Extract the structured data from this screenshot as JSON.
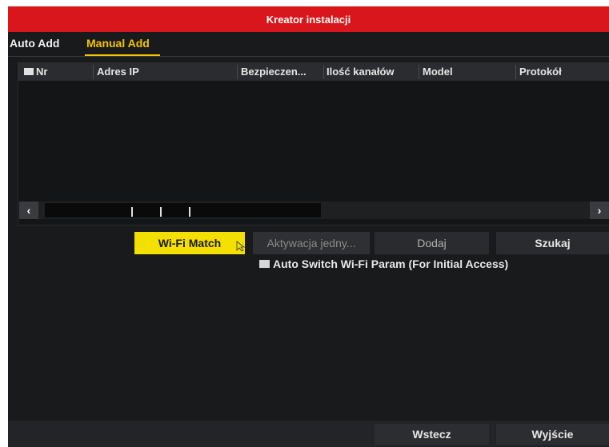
{
  "window": {
    "title": "Kreator instalacji"
  },
  "tabs": [
    {
      "label": "Auto Add",
      "active": false
    },
    {
      "label": "Manual Add",
      "active": true
    }
  ],
  "table": {
    "columns": [
      "Nr",
      "Adres IP",
      "Bezpieczen...",
      "Ilość kanałów",
      "Model",
      "Protokół"
    ],
    "rows": []
  },
  "scrollbar": {
    "left_icon": "‹",
    "right_icon": "›"
  },
  "actions": {
    "wifi_match": "Wi-Fi Match",
    "activate": "Aktywacja jedny...",
    "add": "Dodaj",
    "search": "Szukaj"
  },
  "option": {
    "auto_switch_label": "Auto Switch Wi-Fi Param (For Initial Access)",
    "checked": false
  },
  "footer": {
    "back": "Wstecz",
    "exit": "Wyjście"
  },
  "colors": {
    "accent_red": "#d8161b",
    "accent_yellow": "#f4c400",
    "button_yellow": "#f4e000",
    "background": "#191a1c"
  }
}
